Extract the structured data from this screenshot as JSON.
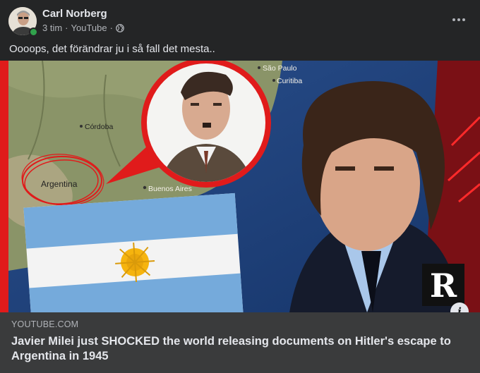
{
  "post": {
    "author": "Carl Norberg",
    "time": "3 tim",
    "source": "YouTube",
    "separator": "·",
    "audience_icon": "globe-icon",
    "text": "Oooops, det förändrar ju i så fall det mesta.."
  },
  "link": {
    "domain": "YOUTUBE.COM",
    "title": "Javier Milei just SHOCKED the world releasing documents on Hitler's escape to Argentina in 1945",
    "info_label": "i",
    "thumbnail": {
      "map_labels": {
        "sao_paulo": "São Paulo",
        "curitiba": "Curitiba",
        "cordoba": "Córdoba",
        "argentina": "Argentina",
        "buenos_aires": "Buenos Aires"
      },
      "badge": "R"
    }
  },
  "colors": {
    "background": "#242526",
    "card_footer": "#3a3b3c",
    "text_primary": "#e4e6eb",
    "text_secondary": "#b0b3b8",
    "online": "#31a24c",
    "highlight_red": "#e01b1b"
  }
}
